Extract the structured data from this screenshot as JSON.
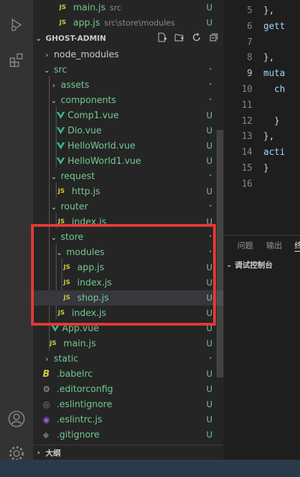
{
  "explorer": {
    "title": "GHOST-ADMIN",
    "open_editors": [
      {
        "name": "main.js",
        "desc": "src",
        "status": "U"
      },
      {
        "name": "app.js",
        "desc": "src\\store\\modules",
        "status": "U"
      }
    ],
    "tree": [
      {
        "name": "node_modules",
        "status": ""
      },
      {
        "name": "src",
        "status": "•"
      },
      {
        "name": "assets",
        "status": "•"
      },
      {
        "name": "components",
        "status": "•"
      },
      {
        "name": "Comp1.vue",
        "status": "U"
      },
      {
        "name": "Dio.vue",
        "status": "U"
      },
      {
        "name": "HelloWorld.vue",
        "status": "U"
      },
      {
        "name": "HelloWorld1.vue",
        "status": "U"
      },
      {
        "name": "request",
        "status": "•"
      },
      {
        "name": "http.js",
        "status": "U"
      },
      {
        "name": "router",
        "status": "•"
      },
      {
        "name": "index.js",
        "status": "U"
      },
      {
        "name": "store",
        "status": "•"
      },
      {
        "name": "modules",
        "status": "•"
      },
      {
        "name": "app.js",
        "status": "U"
      },
      {
        "name": "index.js",
        "status": "U"
      },
      {
        "name": "shop.js",
        "status": "U"
      },
      {
        "name": "index.js",
        "status": "U"
      },
      {
        "name": "App.vue",
        "status": "U"
      },
      {
        "name": "main.js",
        "status": "U"
      },
      {
        "name": "static",
        "status": "•"
      },
      {
        "name": ".babelrc",
        "status": "U"
      },
      {
        "name": ".editorconfig",
        "status": "U"
      },
      {
        "name": ".eslintignore",
        "status": "U"
      },
      {
        "name": ".eslintrc.js",
        "status": "U"
      },
      {
        "name": ".gitignore",
        "status": "U"
      }
    ],
    "outline_label": "大纲"
  },
  "editor": {
    "lines": [
      {
        "n": "5",
        "code": "},"
      },
      {
        "n": "6",
        "code": "gett"
      },
      {
        "n": "7",
        "code": ""
      },
      {
        "n": "8",
        "code": "},"
      },
      {
        "n": "9",
        "code": "muta"
      },
      {
        "n": "10",
        "code": "  ch"
      },
      {
        "n": "11",
        "code": ""
      },
      {
        "n": "12",
        "code": "  }"
      },
      {
        "n": "13",
        "code": "},"
      },
      {
        "n": "14",
        "code": "acti"
      },
      {
        "n": "15",
        "code": "}"
      },
      {
        "n": "16",
        "code": ""
      }
    ]
  },
  "panel": {
    "tabs": [
      "问题",
      "输出",
      "终"
    ],
    "debug_console": "调试控制台"
  },
  "colors": {
    "untracked": "#73c991",
    "highlight_box": "#e53935"
  }
}
